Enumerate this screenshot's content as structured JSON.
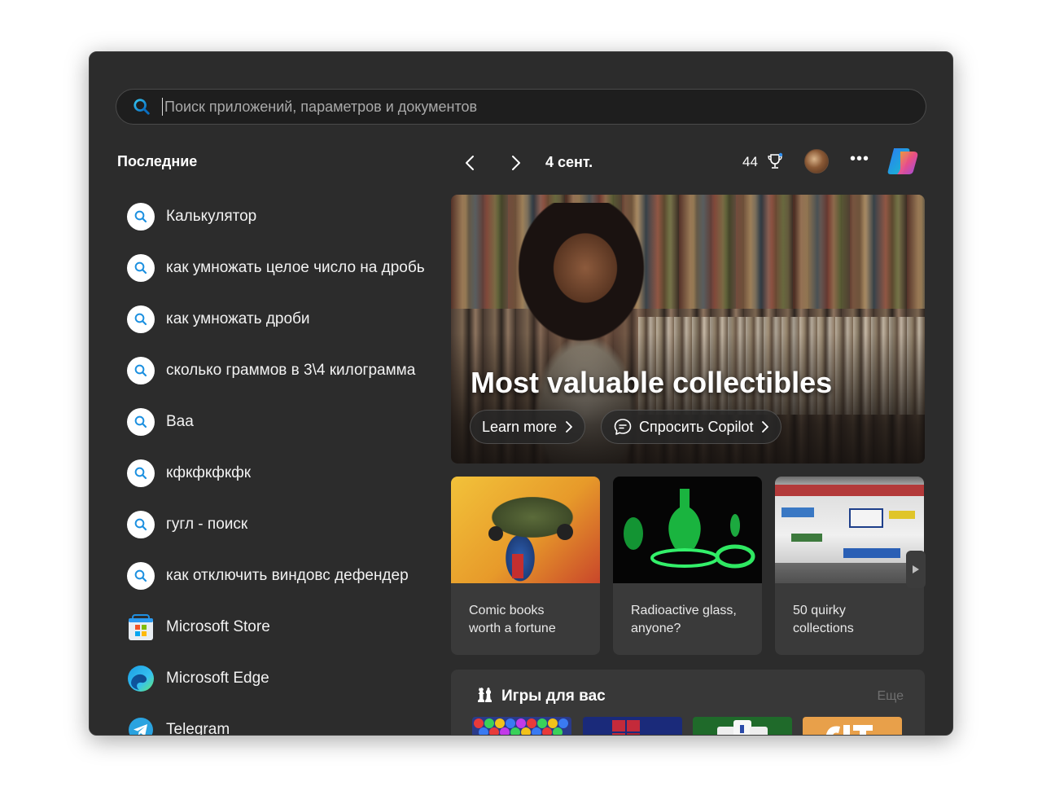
{
  "search": {
    "placeholder": "Поиск приложений, параметров и документов"
  },
  "recent": {
    "title": "Последние",
    "items": [
      {
        "label": "Калькулятор",
        "icon": "search-icon"
      },
      {
        "label": "как умножать целое число на дробь",
        "icon": "search-icon"
      },
      {
        "label": "как умножать дроби",
        "icon": "search-icon"
      },
      {
        "label": "сколько граммов в 3\\4 килограмма",
        "icon": "search-icon"
      },
      {
        "label": "Ваа",
        "icon": "search-icon"
      },
      {
        "label": "кфкфкфкфк",
        "icon": "search-icon"
      },
      {
        "label": "гугл - поиск",
        "icon": "search-icon"
      },
      {
        "label": "как отключить виндовс дефендер",
        "icon": "search-icon"
      },
      {
        "label": "Microsoft Store",
        "icon": "microsoft-store-icon"
      },
      {
        "label": "Microsoft Edge",
        "icon": "microsoft-edge-icon"
      },
      {
        "label": "Telegram",
        "icon": "telegram-icon"
      }
    ]
  },
  "header": {
    "date": "4 сент.",
    "points": "44"
  },
  "hero": {
    "title": "Most valuable collectibles",
    "learn_more": "Learn more",
    "ask_copilot": "Спросить Copilot"
  },
  "cards": [
    {
      "text_line1": "Comic books",
      "text_line2": "worth a fortune"
    },
    {
      "text_line1": "Radioactive glass,",
      "text_line2": "anyone?"
    },
    {
      "text_line1": "50 quirky",
      "text_line2": "collections"
    }
  ],
  "games": {
    "title": "Игры для вас",
    "more": "Еще"
  },
  "colors": {
    "panel_bg": "#2c2c2c",
    "accent_blue": "#0a7fd9",
    "card_bg": "#3a3a3a"
  }
}
